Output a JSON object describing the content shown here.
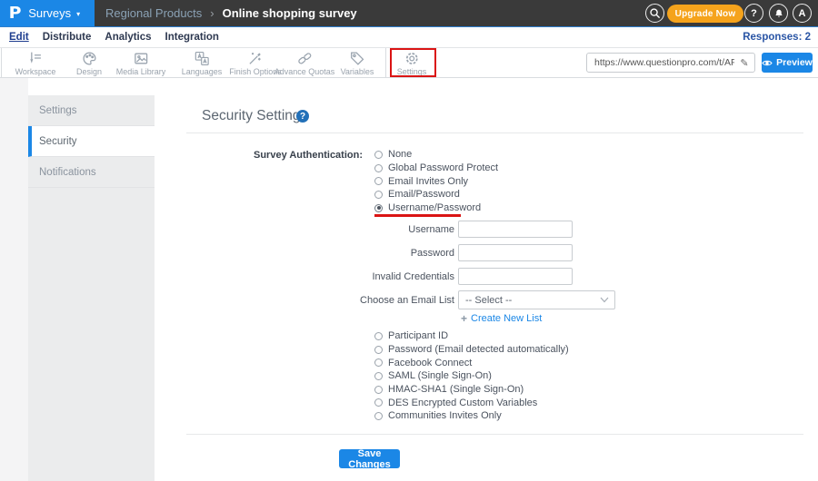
{
  "colors": {
    "accent_blue": "#1b87e6",
    "topbar_bg": "#3a3a3a",
    "upgrade_orange": "#f5a31c",
    "annotation_red": "#da1414",
    "sidebar_bg": "#ebeced"
  },
  "header": {
    "brand": {
      "logo_letter": "P",
      "label": "Surveys",
      "caret": "▾"
    },
    "breadcrumb": {
      "folder": "Regional Products",
      "separator": "›",
      "survey": "Online shopping survey"
    },
    "actions": {
      "upgrade": "Upgrade Now",
      "help": "?",
      "avatar": "A"
    }
  },
  "nav": {
    "tabs": [
      {
        "label": "Edit",
        "active": true
      },
      {
        "label": "Distribute",
        "active": false
      },
      {
        "label": "Analytics",
        "active": false
      },
      {
        "label": "Integration",
        "active": false
      }
    ],
    "responses": "Responses: 2"
  },
  "toolbar": {
    "items": [
      {
        "label": "Workspace",
        "icon": "workspace-icon"
      },
      {
        "label": "Design",
        "icon": "design-icon"
      },
      {
        "label": "Media Library",
        "icon": "media-library-icon"
      },
      {
        "label": "Languages",
        "icon": "languages-icon"
      },
      {
        "label": "Finish Options",
        "icon": "finish-options-icon"
      },
      {
        "label": "Advance Quotas",
        "icon": "advance-quotas-icon"
      },
      {
        "label": "Variables",
        "icon": "variables-icon"
      },
      {
        "label": "Settings",
        "icon": "settings-icon",
        "highlighted": true
      }
    ],
    "survey_url": {
      "value": "https://www.questionpro.com/t/APNrFZ"
    },
    "preview_label": "Preview"
  },
  "sidebar": {
    "items": [
      {
        "label": "Settings",
        "active": false
      },
      {
        "label": "Security",
        "active": true
      },
      {
        "label": "Notifications",
        "active": false
      }
    ]
  },
  "content": {
    "title": "Security Settings",
    "help_icon": "?",
    "auth_label": "Survey Authentication:",
    "auth_options_top": [
      "None",
      "Global Password Protect",
      "Email Invites Only",
      "Email/Password",
      "Username/Password"
    ],
    "selected_option": "Username/Password",
    "fields": [
      {
        "label": "Username",
        "value": ""
      },
      {
        "label": "Password",
        "value": ""
      },
      {
        "label": "Invalid Credentials",
        "value": ""
      }
    ],
    "email_list": {
      "label": "Choose an Email List",
      "selected": "-- Select --"
    },
    "create_list": {
      "plus": "+",
      "label": "Create New List"
    },
    "auth_options_bottom": [
      "Participant ID",
      "Password (Email detected automatically)",
      "Facebook Connect",
      "SAML (Single Sign-On)",
      "HMAC-SHA1 (Single Sign-On)",
      "DES Encrypted Custom Variables",
      "Communities Invites Only"
    ],
    "save_label": "Save Changes"
  }
}
